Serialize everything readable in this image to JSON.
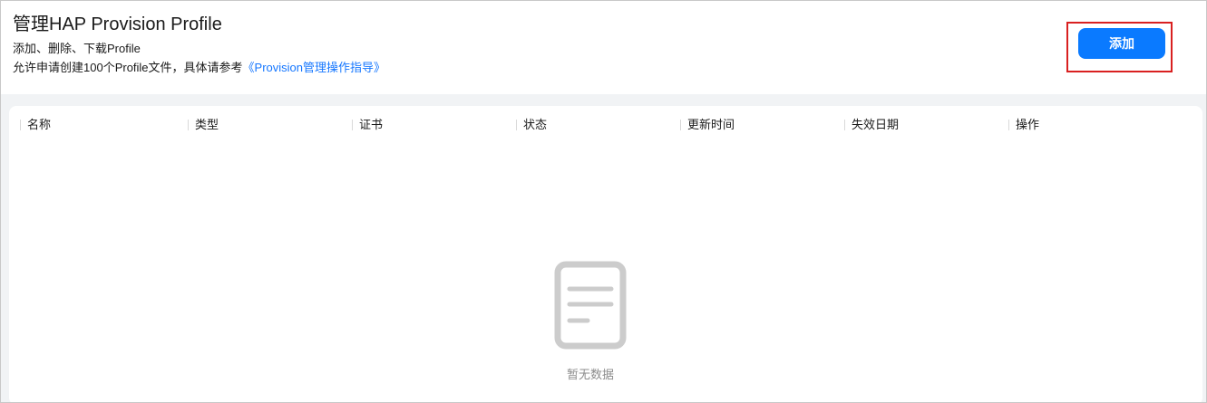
{
  "header": {
    "title": "管理HAP Provision Profile",
    "subtitle": "添加、删除、下载Profile",
    "description_prefix": "允许申请创建100个Profile文件，具体请参考",
    "guide_link": "《Provision管理操作指导》",
    "add_button_label": "添加"
  },
  "table": {
    "columns": [
      "名称",
      "类型",
      "证书",
      "状态",
      "更新时间",
      "失效日期",
      "操作"
    ],
    "empty_text": "暂无数据",
    "empty_icon": "document-icon"
  },
  "colors": {
    "accent": "#0a7aff",
    "link": "#1677ff",
    "highlight_border": "#d92020",
    "empty_icon": "#cccccc"
  }
}
